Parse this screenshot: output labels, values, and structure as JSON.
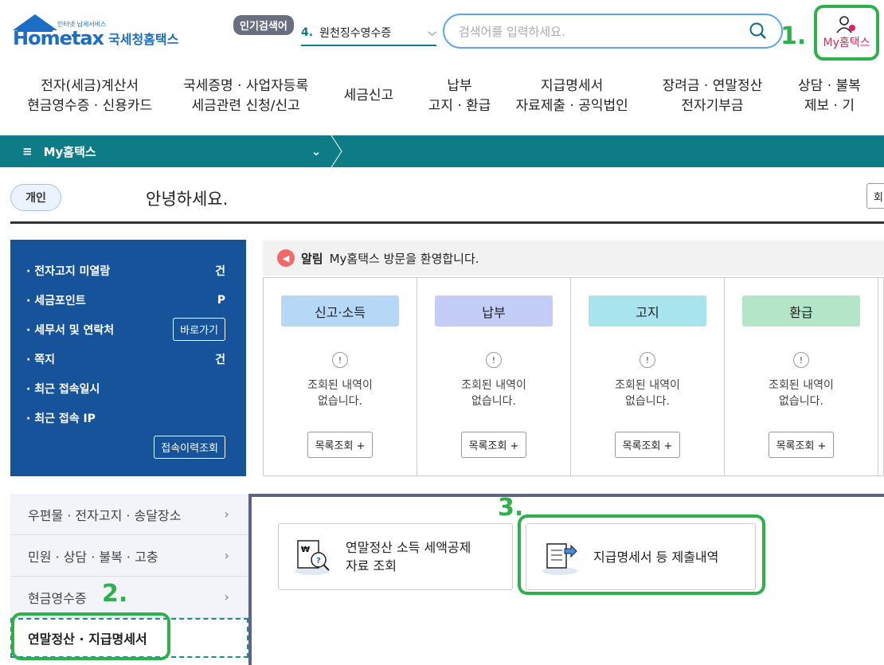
{
  "header": {
    "logo_small": "인터넷 납세서비스",
    "logo_main": "Hometax",
    "logo_kr": "국세청홈택스",
    "popular_badge": "인기검색어",
    "popular_rank": "4.",
    "popular_term": "원천징수영수증",
    "search_placeholder": "검색어를 입력하세요.",
    "my_label": "My홈택스"
  },
  "annotations": {
    "a1": "1.",
    "a2": "2.",
    "a3": "3."
  },
  "nav": [
    [
      "전자(세금)계산서",
      "현금영수증 · 신용카드"
    ],
    [
      "국세증명 · 사업자등록",
      "세금관련 신청/신고"
    ],
    [
      "세금신고"
    ],
    [
      "납부",
      "고지 · 환급"
    ],
    [
      "지급명세서",
      "자료제출 · 공익법인"
    ],
    [
      "장려금 · 연말정산",
      "전자기부금"
    ],
    [
      "상담 · 불복",
      "제보 · 기"
    ]
  ],
  "teal_bar": {
    "title": "My홈택스"
  },
  "welcome": {
    "chip": "개인",
    "greeting": "안녕하세요.",
    "right_btn": "회"
  },
  "info": {
    "rows": [
      {
        "label": "· 전자고지 미열람",
        "value": "건"
      },
      {
        "label": "· 세금포인트",
        "value": "P"
      },
      {
        "label": "· 세무서 및 연락처",
        "button": "바로가기"
      },
      {
        "label": "· 쪽지",
        "value": "건"
      },
      {
        "label": "· 최근 접속일시"
      },
      {
        "label": "· 최근 접속 IP"
      }
    ],
    "history_button": "접속이력조회"
  },
  "alert": {
    "label": "알림",
    "text": "My홈택스 방문을 환영합니다."
  },
  "cards": [
    {
      "title": "신고·소득",
      "color": "#b6d8f7"
    },
    {
      "title": "납부",
      "color": "#c3cdf5"
    },
    {
      "title": "고지",
      "color": "#a8e4ee"
    },
    {
      "title": "환급",
      "color": "#b3e6c8"
    }
  ],
  "card_msg1": "조회된 내역이",
  "card_msg2": "없습니다.",
  "card_button": "목록조회 +",
  "menu": {
    "items": [
      "우편물 · 전자고지 · 송달장소",
      "민원 · 상담 · 불복 · 고충",
      "현금영수증"
    ],
    "active": "연말정산 · 지급명세서"
  },
  "services": [
    {
      "line1": "연말정산 소득 세액공제",
      "line2": "자료 조회"
    },
    {
      "line1": "지급명세서 등 제출내역"
    }
  ]
}
